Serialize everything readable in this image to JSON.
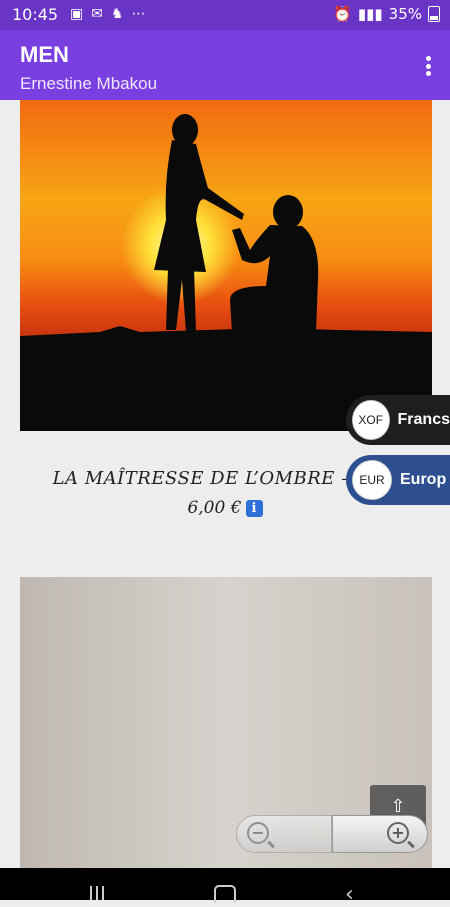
{
  "status": {
    "time": "10:45",
    "battery": "35%"
  },
  "appbar": {
    "title": "MEN",
    "subtitle": "Ernestine Mbakou"
  },
  "products": [
    {
      "title": "LA MAÎTRESSE DE L’OMBRE – PDF",
      "price": "6,00 €"
    }
  ],
  "currency_switcher": [
    {
      "code": "XOF",
      "name": "Francs",
      "color": "#1e1e1e"
    },
    {
      "code": "EUR",
      "name": "Europ",
      "color": "#2d4f8f"
    }
  ],
  "colors": {
    "statusbar": "#6a35c7",
    "appbar": "#7a3fe0",
    "info_icon": "#2f70d8"
  },
  "icons": {
    "info": "i",
    "scroll_top": "⇧"
  }
}
